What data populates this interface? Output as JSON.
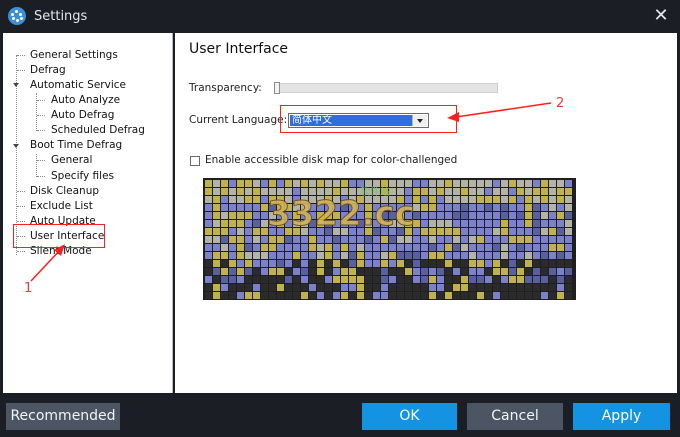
{
  "window": {
    "title": "Settings",
    "close_symbol": "✕"
  },
  "sidebar": {
    "items": [
      {
        "label": "General Settings"
      },
      {
        "label": "Defrag"
      },
      {
        "label": "Automatic Service"
      },
      {
        "label": "Auto Analyze"
      },
      {
        "label": "Auto Defrag"
      },
      {
        "label": "Scheduled Defrag"
      },
      {
        "label": "Boot Time Defrag"
      },
      {
        "label": "General"
      },
      {
        "label": "Specify files"
      },
      {
        "label": "Disk Cleanup"
      },
      {
        "label": "Exclude List"
      },
      {
        "label": "Auto Update"
      },
      {
        "label": "User Interface"
      },
      {
        "label": "Silent Mode"
      }
    ],
    "selected": "User Interface"
  },
  "main": {
    "title": "User Interface",
    "transparency_label": "Transparency:",
    "transparency_value": 0,
    "language_label": "Current Language:",
    "language_value": "简体中文",
    "accessible_label": "Enable accessible disk map for color-challenged",
    "accessible_checked": false
  },
  "disk_map": {
    "colors": {
      "gray": "#b3b3a7",
      "blue": "#7b82c9",
      "olive": "#c2b24f",
      "dark": "#2b2b2b",
      "darkblue": "#58619d"
    }
  },
  "watermark": {
    "text": "3322.cc",
    "subtext": "软件站"
  },
  "annotations": {
    "one": "1",
    "two": "2"
  },
  "buttons": {
    "recommended": "Recommended",
    "ok": "OK",
    "cancel": "Cancel",
    "apply": "Apply"
  },
  "colors": {
    "accent": "#1593e3",
    "annotation": "#ff1f1f",
    "title_bg": "#1b1e24"
  }
}
